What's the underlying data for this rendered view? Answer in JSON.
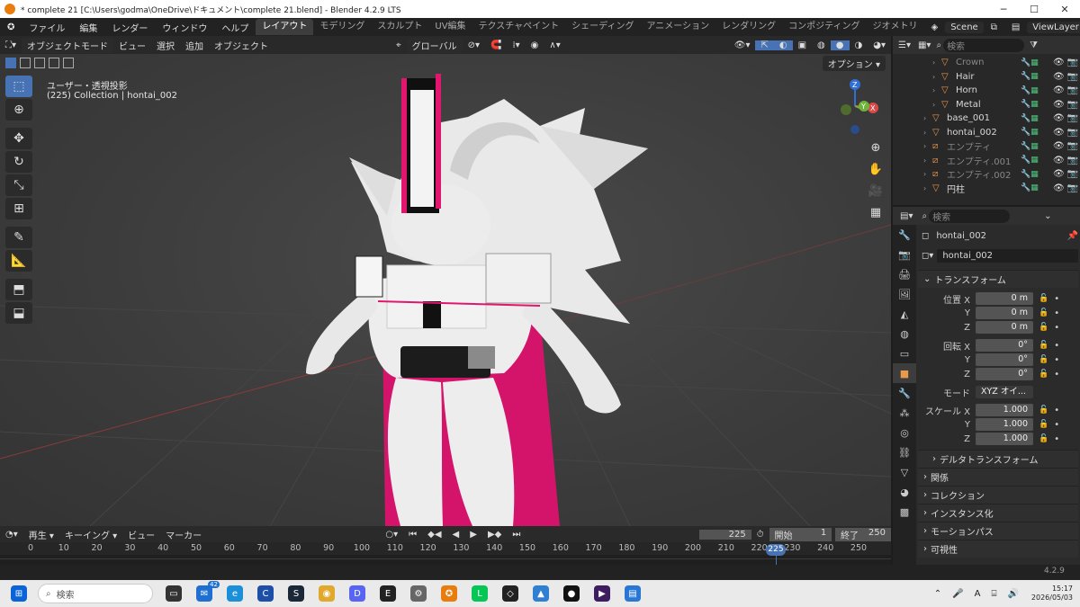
{
  "title": "* complete 21 [C:\\Users\\godma\\OneDrive\\ドキュメント\\complete 21.blend] - Blender 4.2.9 LTS",
  "menu": [
    "ファイル",
    "編集",
    "レンダー",
    "ウィンドウ",
    "ヘルプ"
  ],
  "workspaces": [
    "レイアウト",
    "モデリング",
    "スカルプト",
    "UV編集",
    "テクスチャペイント",
    "シェーディング",
    "アニメーション",
    "レンダリング",
    "コンポジティング",
    "ジオメトリ"
  ],
  "scene": "Scene",
  "viewlayer": "ViewLayer",
  "viewport": {
    "mode": "オブジェクトモード",
    "menus": [
      "ビュー",
      "選択",
      "追加",
      "オブジェクト"
    ],
    "orientation": "グローバル",
    "options_label": "オプション",
    "info_line1": "ユーザー・透視投影",
    "info_line2": "(225) Collection | hontai_002"
  },
  "gizmo": {
    "z": "Z",
    "y": "Y",
    "x": "X"
  },
  "outliner": {
    "search_placeholder": "検索",
    "rows": [
      {
        "name": "Crown",
        "dim": true
      },
      {
        "name": "Hair",
        "dim": false
      },
      {
        "name": "Horn",
        "dim": false
      },
      {
        "name": "Metal",
        "dim": false
      },
      {
        "name": "base_001",
        "dim": false
      },
      {
        "name": "hontai_002",
        "dim": false
      },
      {
        "name": "エンプティ",
        "dim": true
      },
      {
        "name": "エンプティ.001",
        "dim": true
      },
      {
        "name": "エンプティ.002",
        "dim": true
      },
      {
        "name": "円柱",
        "dim": false
      }
    ]
  },
  "properties": {
    "search_placeholder": "検索",
    "object_name": "hontai_002",
    "object_field": "hontai_002",
    "transform_label": "トランスフォーム",
    "location_label": "位置 X",
    "location": [
      "0 m",
      "0 m",
      "0 m"
    ],
    "rotation_label": "回転 X",
    "rotation": [
      "0°",
      "0°",
      "0°"
    ],
    "mode_label": "モード",
    "mode_value": "XYZ オイ...",
    "scale_label": "スケール X",
    "scale": [
      "1.000",
      "1.000",
      "1.000"
    ],
    "axis_y": "Y",
    "axis_z": "Z",
    "sections": [
      "デルタトランスフォーム",
      "関係",
      "コレクション",
      "インスタンス化",
      "モーションパス",
      "可視性"
    ]
  },
  "timeline": {
    "menus": [
      "再生",
      "キーイング",
      "ビュー",
      "マーカー"
    ],
    "current": "225",
    "start_label": "開始",
    "start": "1",
    "end_label": "終了",
    "end": "250",
    "ticks": [
      "0",
      "10",
      "20",
      "30",
      "40",
      "50",
      "60",
      "70",
      "80",
      "90",
      "100",
      "110",
      "120",
      "130",
      "140",
      "150",
      "160",
      "170",
      "180",
      "190",
      "200",
      "210",
      "220",
      "230",
      "240",
      "250"
    ],
    "playhead": "225"
  },
  "version": "4.2.9",
  "taskbar": {
    "search_placeholder": "検索",
    "badge_mail": "42",
    "time": "15:17",
    "date": "2026/05/03",
    "ime": "A"
  }
}
